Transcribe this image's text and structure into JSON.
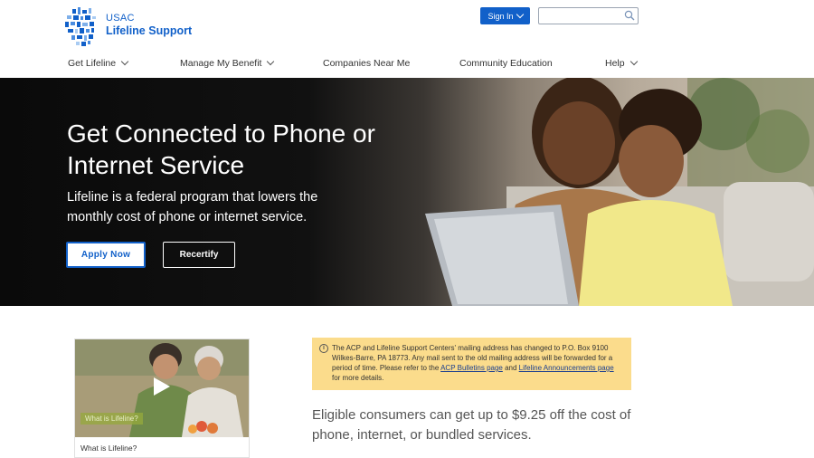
{
  "header": {
    "logo_usac": "USAC",
    "logo_name": "Lifeline Support",
    "signin_label": "Sign In",
    "search_placeholder": ""
  },
  "nav": {
    "items": [
      {
        "label": "Get Lifeline",
        "has_dropdown": true
      },
      {
        "label": "Manage My Benefit",
        "has_dropdown": true
      },
      {
        "label": "Companies Near Me",
        "has_dropdown": false
      },
      {
        "label": "Community Education",
        "has_dropdown": false
      },
      {
        "label": "Help",
        "has_dropdown": true
      }
    ]
  },
  "hero": {
    "title": "Get Connected to Phone or Internet Service",
    "subtitle": "Lifeline is a federal program that lowers the monthly cost of phone or internet service.",
    "apply_label": "Apply Now",
    "recertify_label": "Recertify"
  },
  "video": {
    "tag": "What is Lifeline?",
    "caption": "What is Lifeline?"
  },
  "alert": {
    "text_before": "The ACP and Lifeline Support Centers' mailing address has changed to P.O. Box 9100 Wilkes-Barre, PA 18773. Any mail sent to the old mailing address will be forwarded for a period of time. Please refer to the ",
    "link1": "ACP Bulletins page",
    "text_middle": " and ",
    "link2": "Lifeline Announcements page",
    "text_after": " for more details."
  },
  "eligible_text": "Eligible consumers can get up to $9.25 off the cost of phone, internet, or bundled services.",
  "colors": {
    "brand_blue": "#1160c9",
    "alert_bg": "#fbdc8c"
  }
}
